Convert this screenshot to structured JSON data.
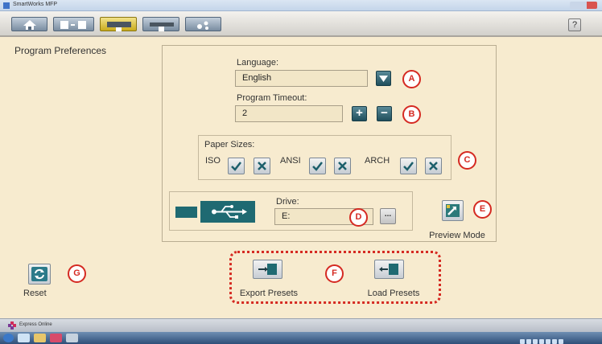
{
  "window": {
    "title": "SmartWorks MFP"
  },
  "toolbar": {
    "buttons": [
      {
        "name": "home",
        "icon": "home-icon"
      },
      {
        "name": "copy",
        "icon": "copy-icon"
      },
      {
        "name": "scan",
        "icon": "scan-icon"
      },
      {
        "name": "print",
        "icon": "print-icon"
      },
      {
        "name": "settings",
        "icon": "settings-icon"
      }
    ],
    "help_label": "?"
  },
  "page": {
    "title": "Program Preferences"
  },
  "language": {
    "label": "Language:",
    "value": "English",
    "callout": "A"
  },
  "timeout": {
    "label": "Program Timeout:",
    "value": "2",
    "plus": "+",
    "minus": "−",
    "callout": "B"
  },
  "paper": {
    "label": "Paper Sizes:",
    "callout": "C",
    "groups": [
      {
        "name": "ISO"
      },
      {
        "name": "ANSI"
      },
      {
        "name": "ARCH"
      }
    ]
  },
  "drive": {
    "label": "Drive:",
    "value": "E:",
    "browse_label": "...",
    "callout": "D"
  },
  "preview": {
    "label": "Preview Mode",
    "callout": "E"
  },
  "presets": {
    "export_label": "Export Presets",
    "load_label": "Load Presets",
    "callout": "F"
  },
  "reset": {
    "label": "Reset",
    "callout": "G"
  },
  "statusbar": {
    "text": "Express Online"
  },
  "colors": {
    "teal": "#1f6a72",
    "callout_red": "#d52a22",
    "background": "#f7ebcf"
  }
}
